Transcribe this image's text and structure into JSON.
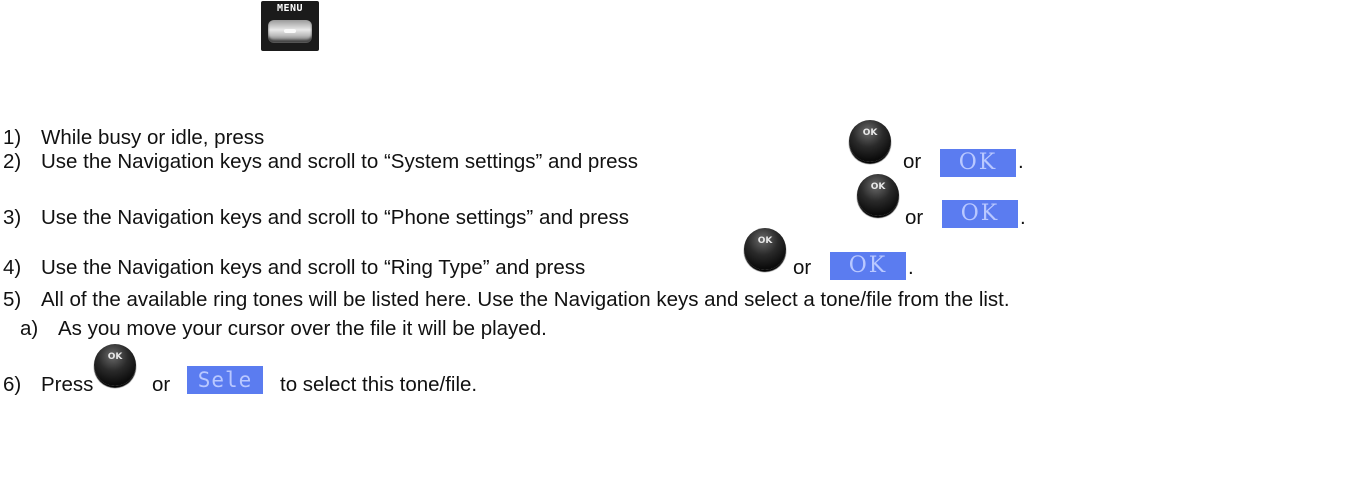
{
  "steps": [
    {
      "num": "1)",
      "text": "While busy or idle, press",
      "key": "MENU"
    },
    {
      "num": "2)",
      "text": "Use the Navigation keys and scroll to “System settings” and press",
      "key_label": "OK",
      "or": "or",
      "soft": "OK",
      "end": "."
    },
    {
      "num": "3)",
      "text": "Use the Navigation keys and scroll to “Phone settings” and press",
      "key_label": "OK",
      "or": "or",
      "soft": "OK",
      "end": "."
    },
    {
      "num": "4)",
      "text": "Use the Navigation keys and scroll to “Ring Type” and press",
      "key_label": "OK",
      "or": "or",
      "soft": "OK",
      "end": "."
    },
    {
      "num": "5)",
      "text": "All of the available ring tones will be listed here. Use the Navigation keys and select a tone/file from the list."
    },
    {
      "num": "6)",
      "pre": "Press",
      "key_label": "OK",
      "or": "or",
      "soft": "Sele",
      "text": "to select this tone/file."
    }
  ],
  "substeps": [
    {
      "num": "a)",
      "text": "As you move your cursor over the file it will be played."
    }
  ],
  "colors": {
    "softkey_bg": "#5b7cf0",
    "softkey_text": "#b9c8ff",
    "key_dark": "#111111"
  }
}
